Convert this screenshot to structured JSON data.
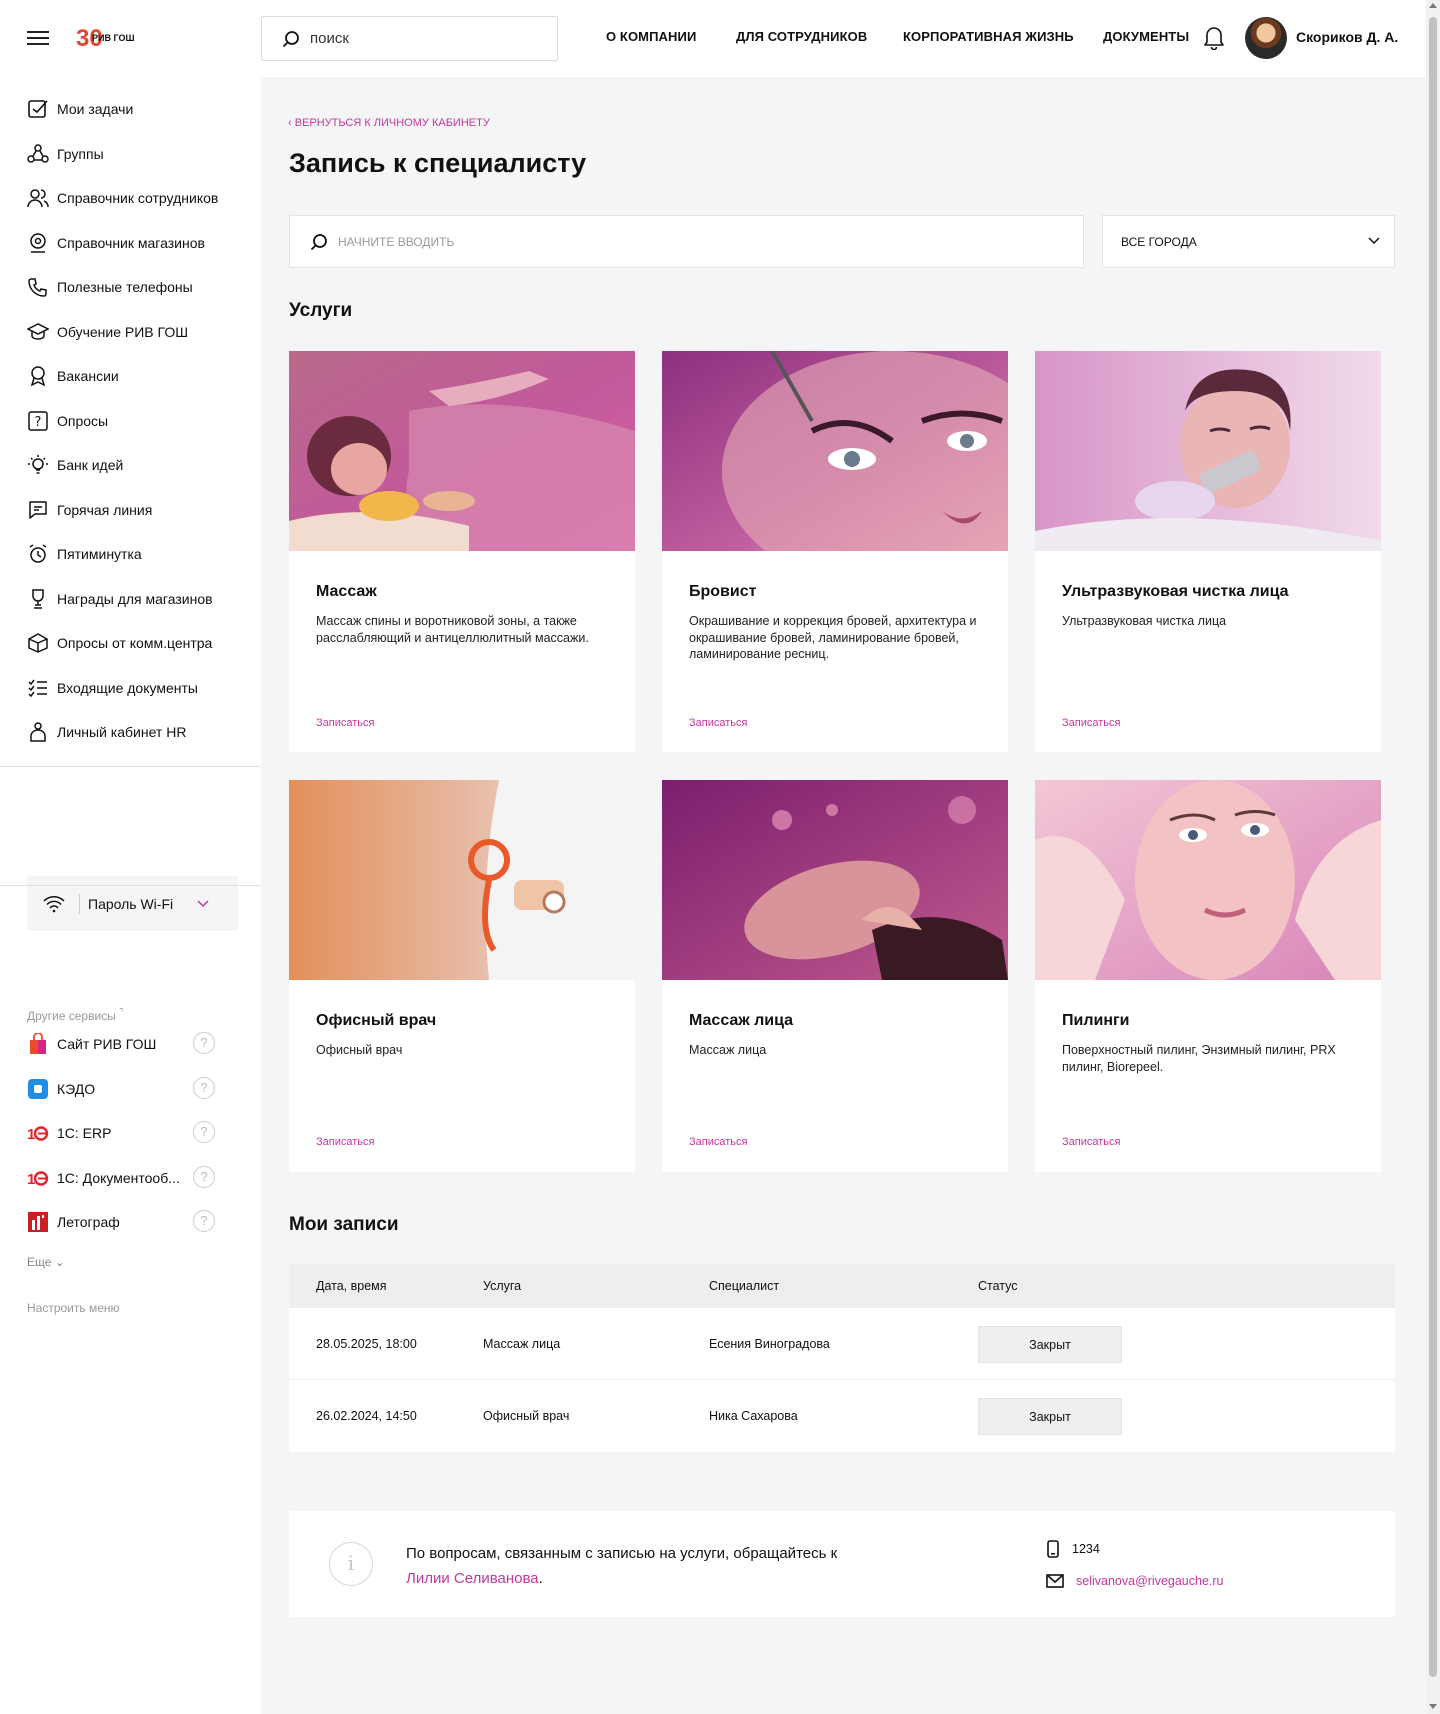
{
  "header": {
    "logo_text": "РИВ ГОШ",
    "logo_number": "30",
    "search_placeholder": "поиск",
    "nav": [
      "О КОМПАНИИ",
      "ДЛЯ СОТРУДНИКОВ",
      "КОРПОРАТИВНАЯ ЖИЗНЬ",
      "ДОКУМЕНТЫ"
    ],
    "user_name": "Скориков Д. А."
  },
  "sidebar": {
    "items": [
      {
        "label": "Мои задачи",
        "icon": "checkbox-icon"
      },
      {
        "label": "Группы",
        "icon": "groups-icon"
      },
      {
        "label": "Справочник сотрудников",
        "icon": "people-icon"
      },
      {
        "label": "Справочник магазинов",
        "icon": "map-pin-icon"
      },
      {
        "label": "Полезные телефоны",
        "icon": "phone-icon"
      },
      {
        "label": "Обучение РИВ ГОШ",
        "icon": "graduation-cap-icon"
      },
      {
        "label": "Вакансии",
        "icon": "badge-icon"
      },
      {
        "label": "Опросы",
        "icon": "question-icon"
      },
      {
        "label": "Банк идей",
        "icon": "lightbulb-icon"
      },
      {
        "label": "Горячая линия",
        "icon": "chat-icon"
      },
      {
        "label": "Пятиминутка",
        "icon": "alarm-clock-icon"
      },
      {
        "label": "Награды для магазинов",
        "icon": "trophy-icon"
      },
      {
        "label": "Опросы от комм.центра",
        "icon": "box-icon"
      },
      {
        "label": "Входящие документы",
        "icon": "list-check-icon"
      },
      {
        "label": "Личный кабинет HR",
        "icon": "hand-icon"
      }
    ],
    "wifi_label": "Пароль Wi-Fi",
    "other_services_label": "Другие сервисы",
    "services": [
      {
        "label": "Сайт РИВ ГОШ",
        "icon": "shopping-bag-icon"
      },
      {
        "label": "КЭДО",
        "icon": "kedo-icon"
      },
      {
        "label": "1С: ERP",
        "icon": "1c-icon"
      },
      {
        "label": "1С: Документооб...",
        "icon": "1c-icon"
      },
      {
        "label": "Летограф",
        "icon": "letograf-icon"
      }
    ],
    "more_label": "Еще",
    "configure_label": "Настроить меню"
  },
  "main": {
    "back_label": "ВЕРНУТЬСЯ К ЛИЧНОМУ КАБИНЕТУ",
    "title": "Запись к специалисту",
    "search_placeholder": "НАЧНИТЕ ВВОДИТЬ",
    "city_value": "ВСЕ ГОРОДА",
    "services_heading": "Услуги",
    "book_label": "Записаться",
    "cards": [
      {
        "title": "Массаж",
        "desc": "Массаж спины и воротниковой зоны, а также расслабляющий и антицеллюлитный массажи."
      },
      {
        "title": "Бровист",
        "desc": "Окрашивание и коррекция бровей, архитектура и окрашивание бровей, ламинирование бровей, ламинирование ресниц."
      },
      {
        "title": "Ультразвуковая чистка лица",
        "desc": "Ультразвуковая чистка лица"
      },
      {
        "title": "Офисный врач",
        "desc": "Офисный врач"
      },
      {
        "title": "Массаж лица",
        "desc": "Массаж лица"
      },
      {
        "title": "Пилинги",
        "desc": "Поверхностный пилинг, Энзимный пилинг, PRX пилинг, Biorepeel."
      }
    ],
    "my_bookings_heading": "Мои записи",
    "table": {
      "headers": [
        "Дата, время",
        "Услуга",
        "Специалист",
        "Статус"
      ],
      "rows": [
        {
          "date": "28.05.2025, 18:00",
          "service": "Массаж лица",
          "specialist": "Есения Виноградова",
          "status": "Закрыт"
        },
        {
          "date": "26.02.2024, 14:50",
          "service": "Офисный врач",
          "specialist": "Ника Сахарова",
          "status": "Закрыт"
        }
      ]
    },
    "info": {
      "text": "По вопросам, связанным с записью на услуги, обращайтесь к",
      "person": "Лилии Селиванова",
      "phone": "1234",
      "email": "selivanova@rivegauche.ru"
    }
  },
  "colors": {
    "accent": "#c2389d",
    "background": "#f5f5f7"
  }
}
